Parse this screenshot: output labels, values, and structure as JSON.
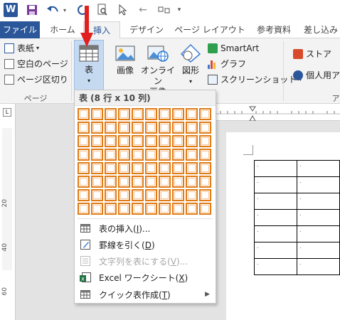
{
  "titlebar": {
    "logo": "W",
    "icons": [
      "word-logo",
      "save-icon",
      "undo-icon",
      "redo-icon",
      "print-preview-icon",
      "pointer-icon",
      "back-icon",
      "more-icon",
      "customize-icon"
    ]
  },
  "tabs": [
    {
      "label": "ファイル",
      "active": false,
      "file": true
    },
    {
      "label": "ホーム",
      "active": false
    },
    {
      "label": "挿入",
      "active": true
    },
    {
      "label": "デザイン",
      "active": false
    },
    {
      "label": "ページ レイアウト",
      "active": false
    },
    {
      "label": "参考資料",
      "active": false
    },
    {
      "label": "差し込み",
      "active": false
    }
  ],
  "ribbon": {
    "pages": {
      "cover": "表紙",
      "blank": "空白のページ",
      "break": "ページ区切り",
      "label": "ページ"
    },
    "table": {
      "label": "表"
    },
    "image": {
      "label": "画像"
    },
    "online_image": {
      "label1": "オンライン",
      "label2": "画像"
    },
    "shape": {
      "label": "図形"
    },
    "smartart": {
      "label": "SmartArt"
    },
    "graph": {
      "label": "グラフ"
    },
    "screenshot": {
      "label": "スクリーンショット"
    },
    "store": {
      "label": "ストア"
    },
    "my_apps": {
      "label": "個人用ア"
    },
    "group_a": {
      "label": "ア"
    }
  },
  "menu": {
    "title": "表 (8 行 x 10 列)",
    "grid": {
      "rows": 8,
      "cols": 10
    },
    "items": [
      {
        "label": "表の挿入(",
        "key": "I",
        "tail": ")...",
        "disabled": false,
        "icon": "insert-table-icon"
      },
      {
        "label": "罫線を引く(",
        "key": "D",
        "tail": ")",
        "disabled": false,
        "icon": "draw-table-icon"
      },
      {
        "label": "文字列を表にする(",
        "key": "V",
        "tail": ")...",
        "disabled": true,
        "icon": "text-to-table-icon"
      },
      {
        "label": "Excel ワークシート(",
        "key": "X",
        "tail": ")",
        "disabled": false,
        "icon": "excel-icon"
      },
      {
        "label": "クイック表作成(",
        "key": "T",
        "tail": ")",
        "disabled": false,
        "icon": "quick-table-icon",
        "submenu": true
      }
    ]
  },
  "ruler": {
    "v_labels": [
      "20",
      "40",
      "60"
    ],
    "h_mark": "L"
  },
  "doc_table": {
    "rows": 7,
    "cols": 2,
    "cell_mark": "."
  }
}
